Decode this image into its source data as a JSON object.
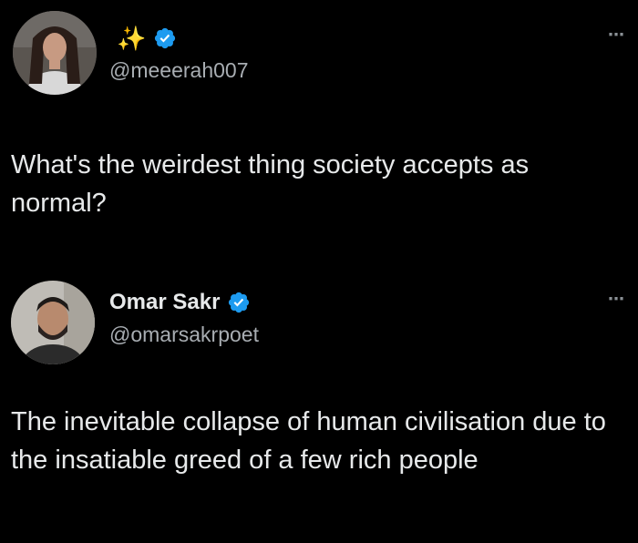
{
  "tweets": [
    {
      "display_name": "",
      "name_emoji": "✨",
      "handle": "@meeerah007",
      "verified": true,
      "text": "What's the weirdest thing society accepts as normal?",
      "more_label": "⋯"
    },
    {
      "display_name": "Omar Sakr",
      "name_emoji": "",
      "handle": "@omarsakrpoet",
      "verified": true,
      "text": "The inevitable collapse of human civilisation due to the insatiable greed of a few rich people",
      "more_label": "⋯"
    }
  ],
  "colors": {
    "background": "#000000",
    "text": "#e7e9ea",
    "secondary_text": "#a8adb2",
    "verified_blue": "#1d9bf0"
  },
  "icons": {
    "verified": "verified-badge-icon",
    "more": "more-options-icon"
  }
}
